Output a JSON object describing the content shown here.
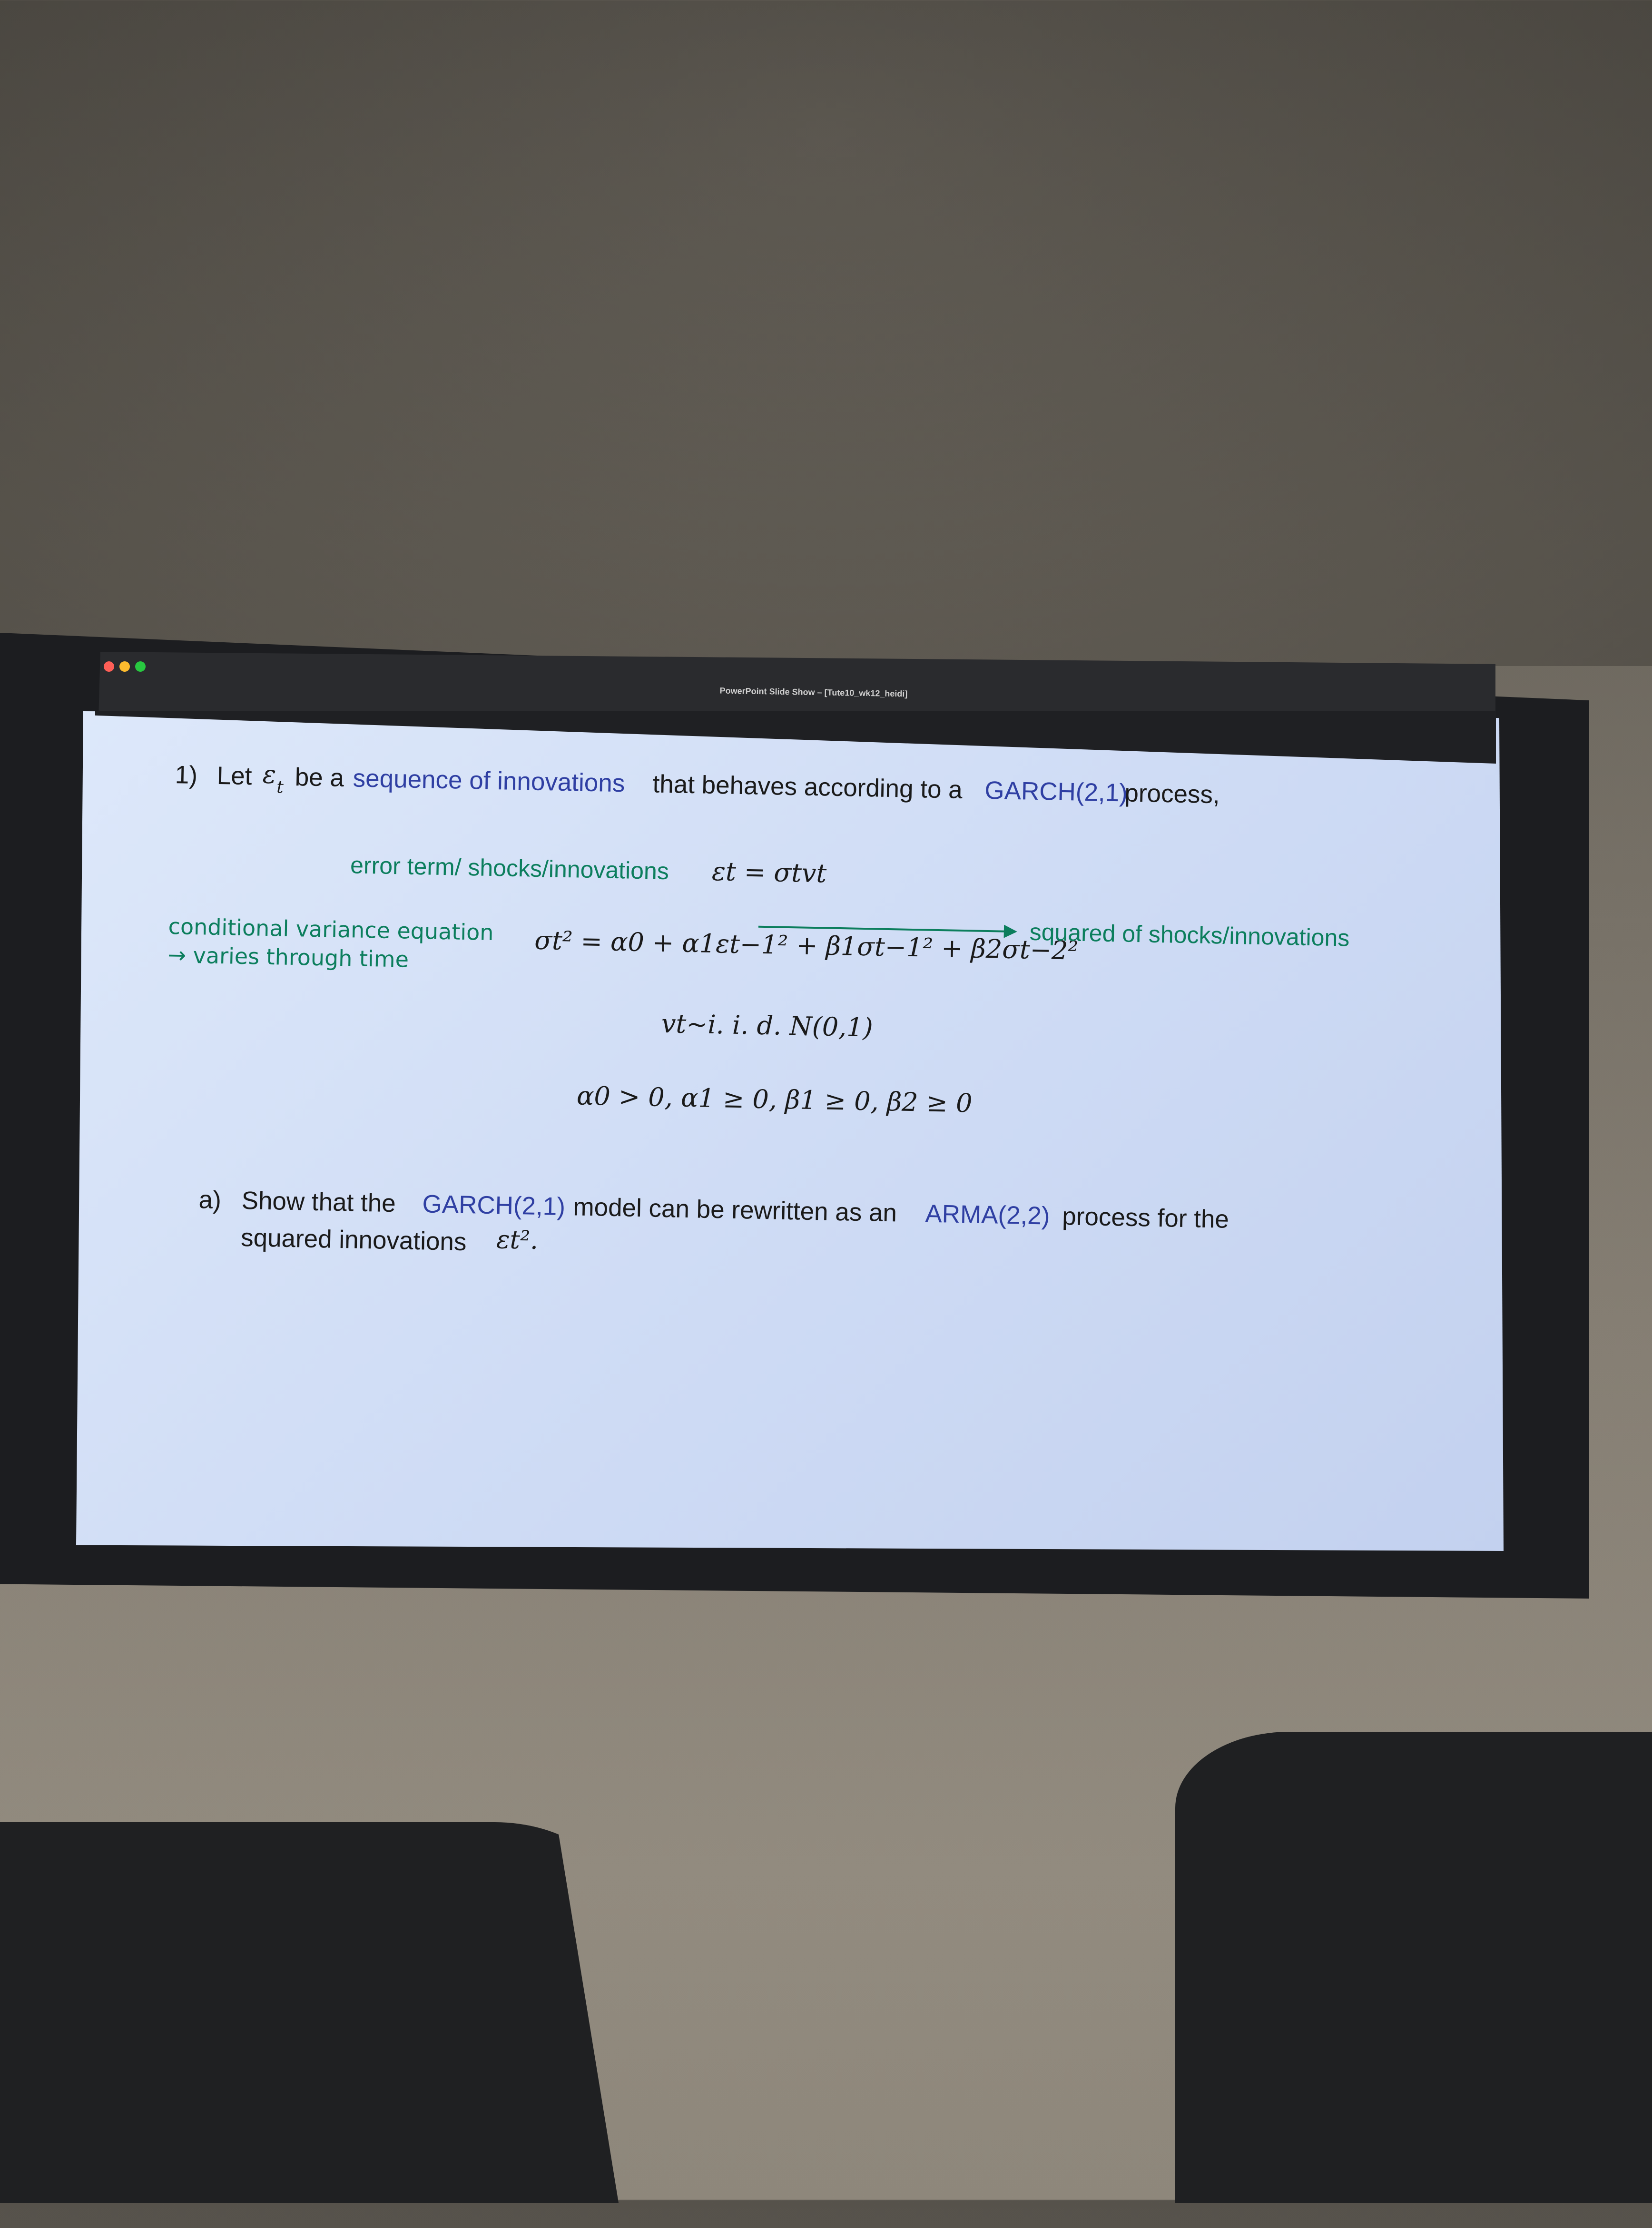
{
  "window": {
    "title": "PowerPoint Slide Show – [Tute10_wk12_heidi]"
  },
  "slide": {
    "q_number": "1)",
    "intro_let": "Let",
    "intro_eps": "ε",
    "intro_eps_sub": "t",
    "intro_be_a": "be a",
    "intro_link": "sequence of innovations",
    "intro_rest": "that behaves according to a",
    "intro_model": "GARCH(2,1)",
    "intro_end": "process,",
    "annot_error": "error term/ shocks/innovations",
    "eq_error": "εt = σtvt",
    "annot_cond_line1": "conditional variance equation",
    "annot_cond_line2": "→ varies through time",
    "eq_variance": "σt² = α0 + α1εt−1² + β1σt−1² + β2σt−2²",
    "annot_squared": "squared of shocks/innovations",
    "eq_iid": "vt~i. i. d. N(0,1)",
    "eq_constraints": "α0 > 0, α1 ≥ 0, β1 ≥ 0, β2 ≥ 0",
    "part_label": "a)",
    "part_a_show": "Show that the",
    "part_a_model1": "GARCH(2,1)",
    "part_a_mid": "model can be rewritten as an",
    "part_a_model2": "ARMA(2,2)",
    "part_a_end": "process for the",
    "part_a_line2": "squared innovations",
    "part_a_eps": "εt²."
  },
  "colors": {
    "accent_green": "#0c7e5d",
    "accent_blue": "#2f3fa3"
  }
}
